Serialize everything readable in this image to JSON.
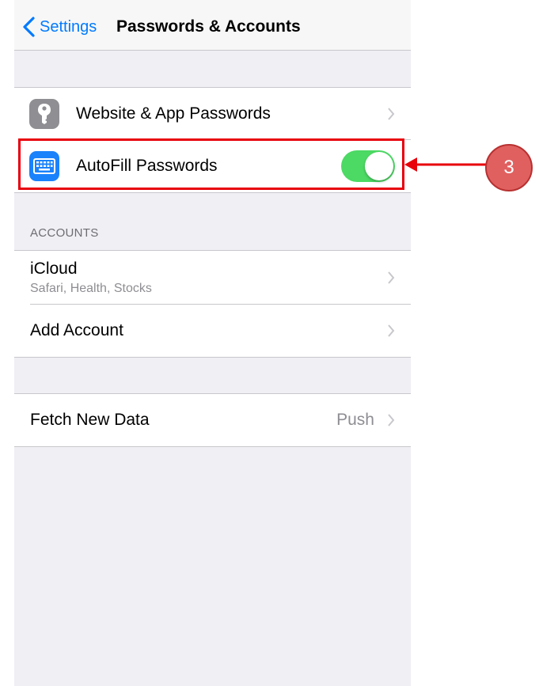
{
  "nav": {
    "back_label": "Settings",
    "title": "Passwords & Accounts"
  },
  "passwords_group": {
    "items": [
      {
        "label": "Website & App Passwords",
        "icon": "key-icon",
        "icon_color": "#8e8e93"
      },
      {
        "label": "AutoFill Passwords",
        "icon": "keyboard-icon",
        "icon_color": "#1a82fb",
        "toggle_on": true
      }
    ]
  },
  "accounts_section": {
    "header": "ACCOUNTS",
    "items": [
      {
        "label": "iCloud",
        "subtitle": "Safari, Health, Stocks"
      },
      {
        "label": "Add Account"
      }
    ]
  },
  "fetch_group": {
    "label": "Fetch New Data",
    "value": "Push"
  },
  "annotation": {
    "step": "3",
    "highlight_color": "#e8000b"
  }
}
